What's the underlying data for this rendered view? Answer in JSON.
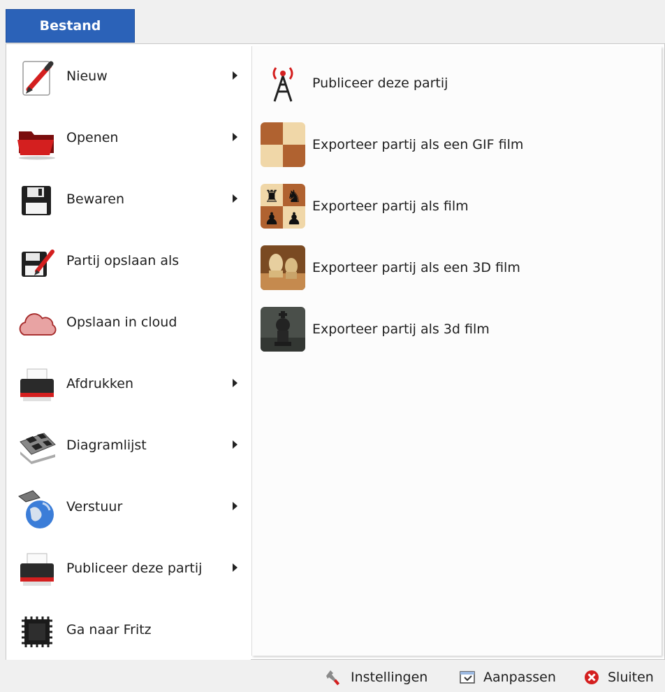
{
  "ribbon": {
    "active_tab": "Bestand"
  },
  "menu": {
    "items": [
      {
        "label": "Nieuw",
        "has_submenu": true,
        "icon": "new-document-pen-icon"
      },
      {
        "label": "Openen",
        "has_submenu": true,
        "icon": "open-folder-icon"
      },
      {
        "label": "Bewaren",
        "has_submenu": true,
        "icon": "floppy-disk-icon"
      },
      {
        "label": "Partij opslaan als",
        "has_submenu": false,
        "icon": "save-as-icon"
      },
      {
        "label": "Opslaan in cloud",
        "has_submenu": false,
        "icon": "cloud-icon"
      },
      {
        "label": "Afdrukken",
        "has_submenu": true,
        "icon": "printer-icon"
      },
      {
        "label": "Diagramlijst",
        "has_submenu": true,
        "icon": "chessboard-diagram-icon"
      },
      {
        "label": "Verstuur",
        "has_submenu": true,
        "icon": "globe-send-icon"
      },
      {
        "label": "Publiceer deze partij",
        "has_submenu": true,
        "icon": "printer-publish-icon"
      },
      {
        "label": "Ga naar Fritz",
        "has_submenu": false,
        "icon": "chip-icon"
      }
    ]
  },
  "submenu": {
    "items": [
      {
        "label": "Publiceer deze partij",
        "icon": "broadcast-tower-icon"
      },
      {
        "label": "Exporteer partij als een  GIF film",
        "icon": "chessboard-squares-icon"
      },
      {
        "label": "Exporteer partij als film",
        "icon": "chess-pieces-icon"
      },
      {
        "label": "Exporteer partij als een 3D film",
        "icon": "chess-3d-pieces-icon"
      },
      {
        "label": "Exporteer partij als 3d film",
        "icon": "dark-chess-king-icon"
      }
    ]
  },
  "footer": {
    "settings": "Instellingen",
    "customize": "Aanpassen",
    "close": "Sluiten"
  },
  "colors": {
    "tab_blue": "#2b62b8",
    "accent_red": "#d41f1f"
  }
}
